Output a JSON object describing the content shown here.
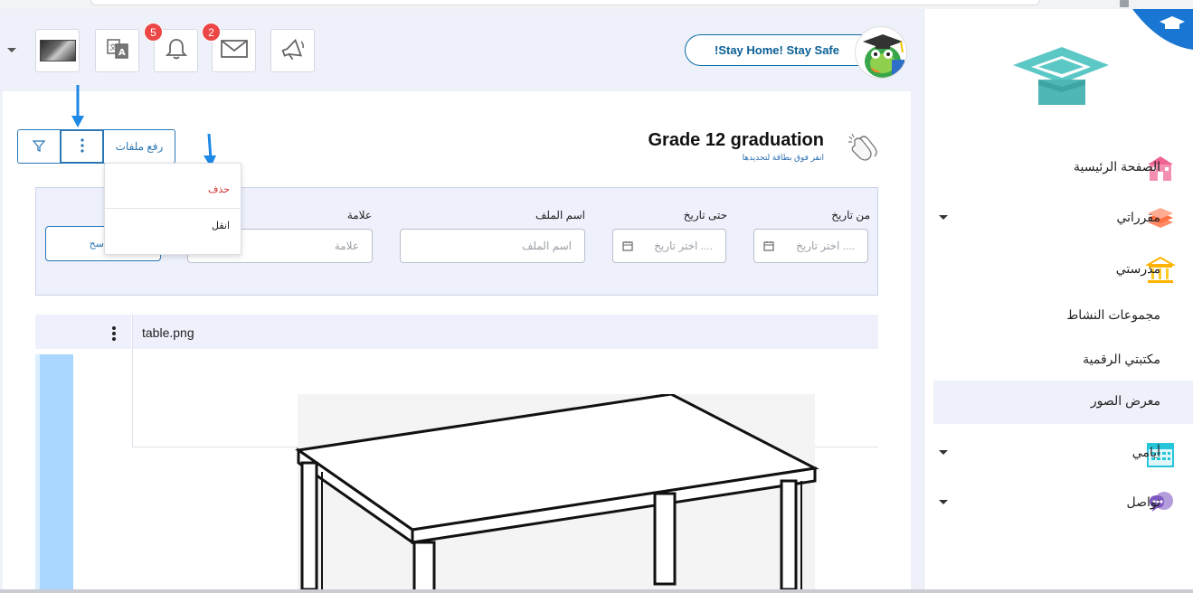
{
  "header": {
    "stay_home_text": "!Stay Home! Stay Safe",
    "notifications_badge": "5",
    "messages_badge": "2"
  },
  "toolbar": {
    "upload_label": "رفع ملفات"
  },
  "dropdown_menu": {
    "delete_label": "حذف",
    "move_label": "انقل"
  },
  "card": {
    "title": "Grade 12 graduation",
    "subtitle": "انقر فوق بطاقة لتحديدها"
  },
  "filters": {
    "from_date_label": "من تاريخ",
    "from_date_placeholder": "اختر تاريخ ....",
    "to_date_label": "حتى تاريخ",
    "to_date_placeholder": "اختر تاريخ ....",
    "file_name_label": "اسم الملف",
    "file_name_placeholder": "اسم الملف",
    "tag_label": "علامة",
    "tag_placeholder": "علامة",
    "clear_label": "سح"
  },
  "gallery": {
    "image_title": "table.png"
  },
  "sidebar": {
    "items": [
      {
        "label": "الصفحة الرئيسية",
        "icon": "school-building-icon",
        "color": "#f06292"
      },
      {
        "label": "مقرراتي",
        "icon": "books-stack-icon",
        "color": "#ff7043"
      },
      {
        "label": "مدرستي",
        "icon": "institution-icon",
        "color": "#ffb300"
      },
      {
        "label": "مجموعات النشاط"
      },
      {
        "label": "مكتبتي الرقمية"
      },
      {
        "label": "معرض الصور"
      },
      {
        "label": "أيامي",
        "icon": "calendar-icon",
        "color": "#26c6da"
      },
      {
        "label": "تواصل",
        "icon": "chat-bubbles-icon",
        "color": "#7e57c2"
      }
    ]
  },
  "colors": {
    "brand_blue": "#2b77b5",
    "badge_red": "#ec4646",
    "delete_red": "#d32f2f",
    "logo_teal": "#4fc3c0"
  }
}
